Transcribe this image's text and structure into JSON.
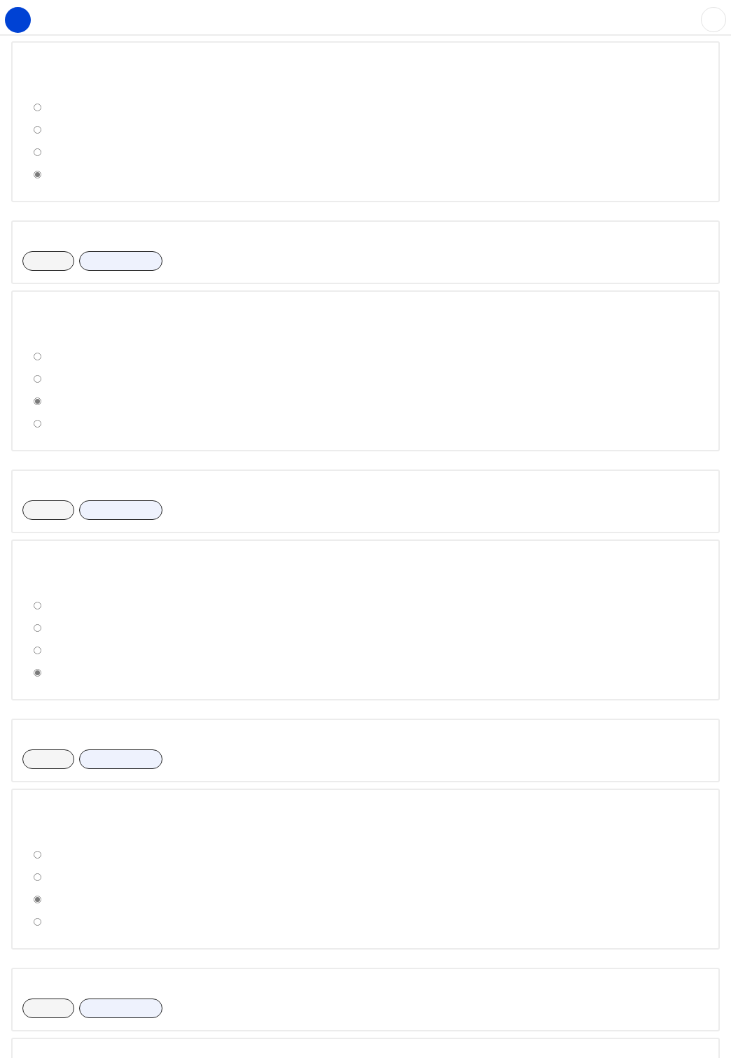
{
  "questions": [
    {
      "options": [
        {
          "selected": false
        },
        {
          "selected": false
        },
        {
          "selected": false
        },
        {
          "selected": true
        }
      ]
    },
    {
      "options": [
        {
          "selected": false
        },
        {
          "selected": false
        },
        {
          "selected": true
        },
        {
          "selected": false
        }
      ]
    },
    {
      "options": [
        {
          "selected": false
        },
        {
          "selected": false
        },
        {
          "selected": false
        },
        {
          "selected": true
        }
      ]
    },
    {
      "options": [
        {
          "selected": false
        },
        {
          "selected": false
        },
        {
          "selected": true
        },
        {
          "selected": false
        }
      ]
    }
  ]
}
